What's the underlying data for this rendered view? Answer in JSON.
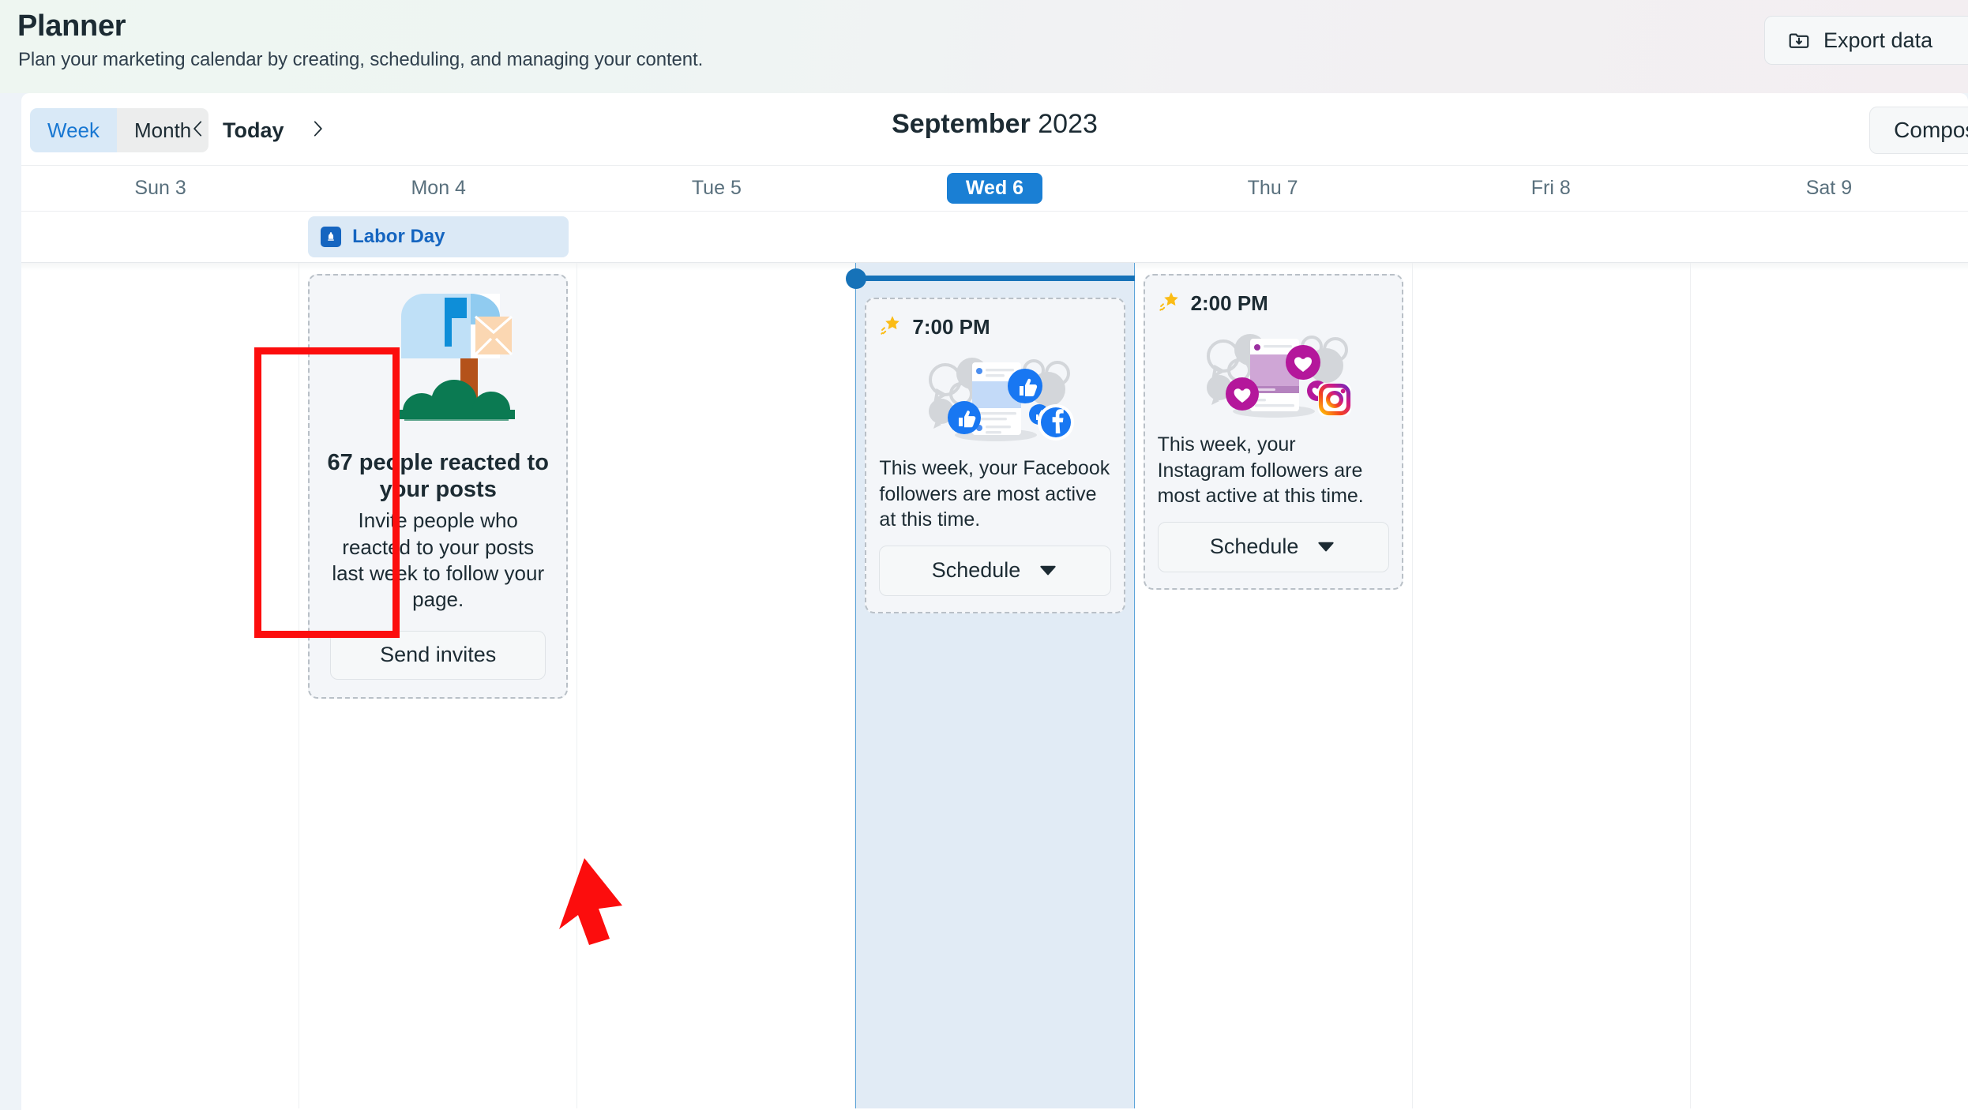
{
  "header": {
    "title": "Planner",
    "subtitle": "Plan your marketing calendar by creating, scheduling, and managing your content.",
    "export_label": "Export data",
    "export_icon": "folder-download-icon"
  },
  "toolbar": {
    "view_week": "Week",
    "view_month": "Month",
    "active_view": "Week",
    "prev_icon": "chevron-left-icon",
    "next_icon": "chevron-right-icon",
    "today_label": "Today",
    "month": "September",
    "year": "2023",
    "compose_label": "Compose",
    "accent_blue": "#1877d2",
    "today_pill_blue": "#1a7fd4"
  },
  "calendar": {
    "days": [
      {
        "label": "Sun 3",
        "today": false
      },
      {
        "label": "Mon 4",
        "today": false
      },
      {
        "label": "Tue 5",
        "today": false
      },
      {
        "label": "Wed 6",
        "today": true
      },
      {
        "label": "Thu 7",
        "today": false
      },
      {
        "label": "Fri 8",
        "today": false
      },
      {
        "label": "Sat 9",
        "today": false
      }
    ],
    "allday": {
      "column_index": 1,
      "label": "Labor Day",
      "icon": "holiday-icon",
      "chip_bg": "#dbe9f6",
      "chip_text": "#1565c0"
    },
    "now_indicator": {
      "column_index": 3,
      "color": "#1672b8"
    },
    "cards": [
      {
        "id": "invite-card",
        "column_index": 1,
        "kind": "mailbox-promo",
        "illustration": "mailbox-illustration",
        "title": "67 people reacted to your posts",
        "body": "Invite people who reacted to your posts last week to follow your page.",
        "button_label": "Send invites"
      },
      {
        "id": "facebook-card",
        "column_index": 3,
        "kind": "best-time",
        "time": "7:00 PM",
        "time_icon": "sparkle-star-icon",
        "illustration": "facebook-engagement-illustration",
        "body": "This week, your Facebook followers are most active at this time.",
        "button_label": "Schedule",
        "button_caret_icon": "caret-down-icon"
      },
      {
        "id": "instagram-card",
        "column_index": 4,
        "kind": "best-time",
        "time": "2:00 PM",
        "time_icon": "sparkle-star-icon",
        "illustration": "instagram-engagement-illustration",
        "body": "This week, your Instagram followers are most active at this time.",
        "button_label": "Schedule",
        "button_caret_icon": "caret-down-icon"
      }
    ]
  },
  "annotations": {
    "highlight_color": "#fc0d0d",
    "highlight_target": "invite-card",
    "arrow_target": "send-invites-button"
  }
}
